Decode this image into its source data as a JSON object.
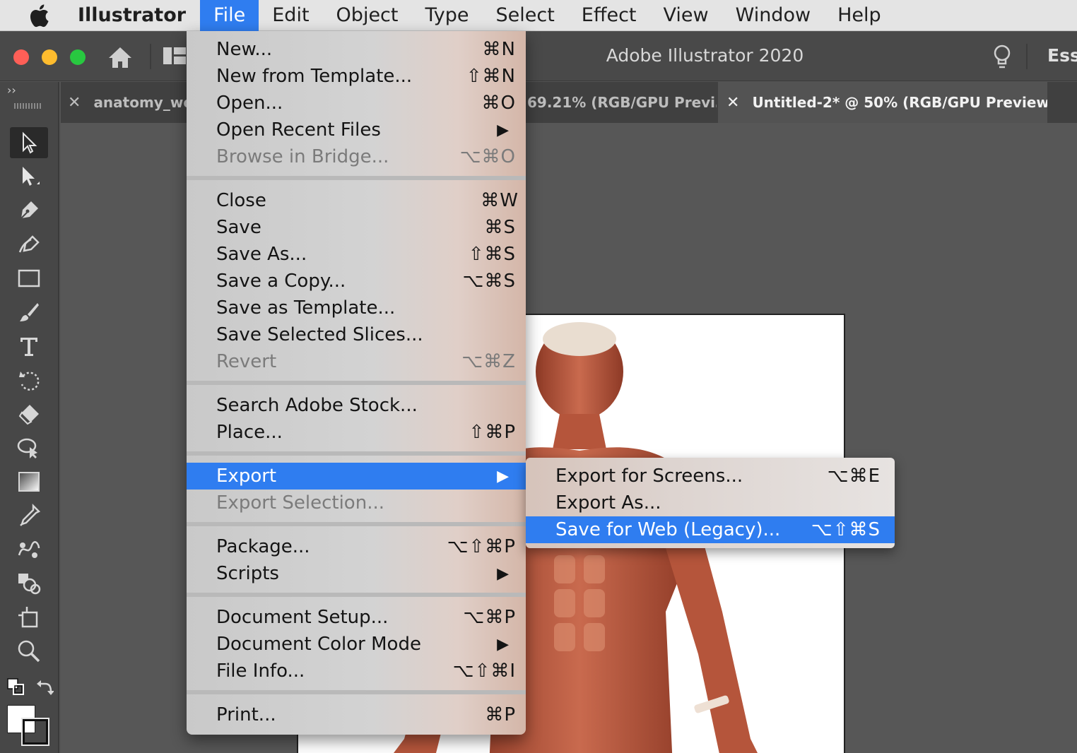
{
  "menubar": {
    "app_name": "Illustrator",
    "menus": [
      "File",
      "Edit",
      "Object",
      "Type",
      "Select",
      "Effect",
      "View",
      "Window",
      "Help"
    ]
  },
  "titlebar": {
    "title": "Adobe Illustrator 2020",
    "workspace": "Ess"
  },
  "toolbar": {
    "collapse": "››"
  },
  "tabs": [
    {
      "label": "anatomy_wo",
      "close": "✕"
    },
    {
      "label": "69.21% (RGB/GPU Previ…",
      "close": ""
    },
    {
      "label": "Untitled-2* @ 50% (RGB/GPU Preview)",
      "close": "✕"
    }
  ],
  "file_menu": {
    "items": [
      {
        "label": "New...",
        "shortcut": "⌘N"
      },
      {
        "label": "New from Template...",
        "shortcut": "⇧⌘N"
      },
      {
        "label": "Open...",
        "shortcut": "⌘O"
      },
      {
        "label": "Open Recent Files",
        "shortcut": "▶"
      },
      {
        "label": "Browse in Bridge...",
        "shortcut": "⌥⌘O"
      },
      {
        "label": "Close",
        "shortcut": "⌘W"
      },
      {
        "label": "Save",
        "shortcut": "⌘S"
      },
      {
        "label": "Save As...",
        "shortcut": "⇧⌘S"
      },
      {
        "label": "Save a Copy...",
        "shortcut": "⌥⌘S"
      },
      {
        "label": "Save as Template...",
        "shortcut": ""
      },
      {
        "label": "Save Selected Slices...",
        "shortcut": ""
      },
      {
        "label": "Revert",
        "shortcut": "⌥⌘Z"
      },
      {
        "label": "Search Adobe Stock...",
        "shortcut": ""
      },
      {
        "label": "Place...",
        "shortcut": "⇧⌘P"
      },
      {
        "label": "Export",
        "shortcut": "▶"
      },
      {
        "label": "Export Selection...",
        "shortcut": ""
      },
      {
        "label": "Package...",
        "shortcut": "⌥⇧⌘P"
      },
      {
        "label": "Scripts",
        "shortcut": "▶"
      },
      {
        "label": "Document Setup...",
        "shortcut": "⌥⌘P"
      },
      {
        "label": "Document Color Mode",
        "shortcut": "▶"
      },
      {
        "label": "File Info...",
        "shortcut": "⌥⇧⌘I"
      },
      {
        "label": "Print...",
        "shortcut": "⌘P"
      }
    ]
  },
  "export_submenu": {
    "items": [
      {
        "label": "Export for Screens...",
        "shortcut": "⌥⌘E"
      },
      {
        "label": "Export As...",
        "shortcut": ""
      },
      {
        "label": "Save for Web (Legacy)...",
        "shortcut": "⌥⇧⌘S"
      }
    ]
  },
  "colors": {
    "highlight": "#2f7df0",
    "menubar": "#e4e4e4",
    "titlebar": "#494949",
    "toolbar": "#474747",
    "canvas": "#575757",
    "close_button": "#fe5f57",
    "minimize_button": "#febc2e",
    "zoom_button": "#28c840",
    "muscle_red": "#b5553b"
  }
}
